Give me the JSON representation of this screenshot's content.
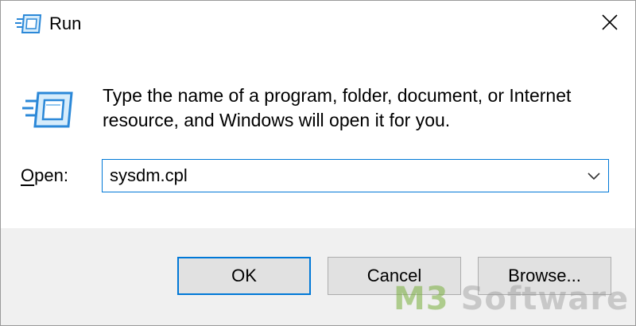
{
  "window": {
    "title": "Run",
    "close_glyph": "✕"
  },
  "icons": {
    "title_icon": "run-icon",
    "main_icon": "run-icon",
    "close_icon": "close-icon",
    "dropdown_icon": "chevron-down-icon"
  },
  "content": {
    "description": "Type the name of a program, folder, document, or Internet resource, and Windows will open it for you.",
    "open_label_accel": "O",
    "open_label_rest": "pen:",
    "open_value": "sysdm.cpl"
  },
  "buttons": {
    "ok_label": "OK",
    "cancel_label": "Cancel",
    "browse_label": "Browse..."
  },
  "watermark": {
    "part1": "M3",
    "part2": " Software"
  },
  "colors": {
    "accent": "#0078d7",
    "footer_bg": "#f0f0f0",
    "button_bg": "#e1e1e1"
  }
}
